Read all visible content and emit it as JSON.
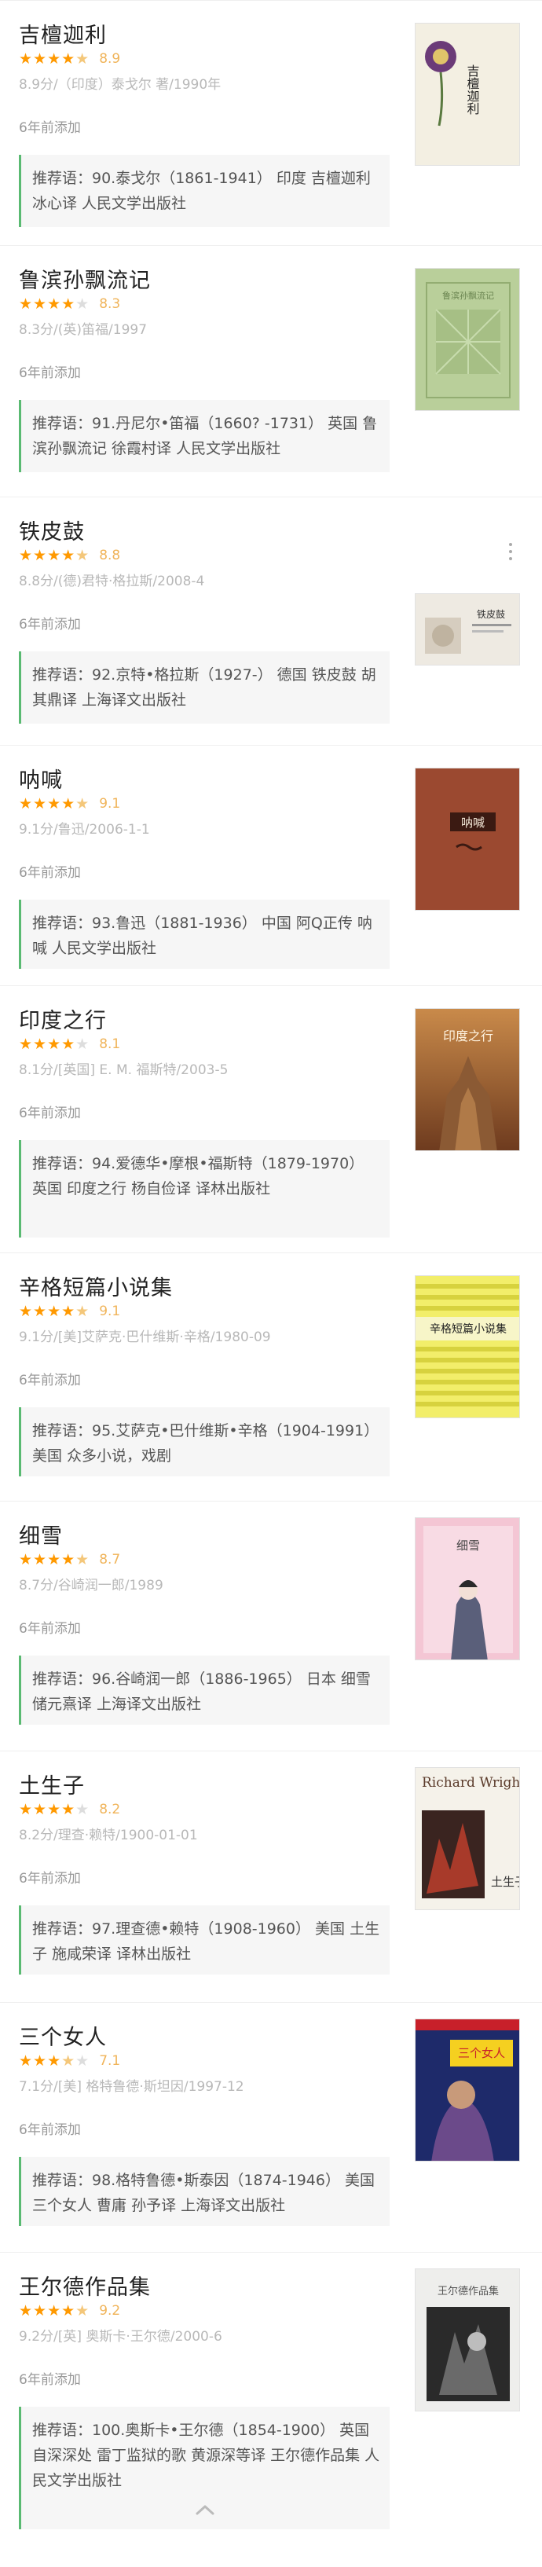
{
  "books": [
    {
      "title": "吉檀迦利",
      "stars": 4.5,
      "score": "8.9",
      "meta": "8.9分/（印度）泰戈尔 著/1990年",
      "added": "6年前添加",
      "recommendation": "推荐语：90.泰戈尔（1861-1941） 印度 吉檀迦利 冰心译 人民文学出版社",
      "cover_text": "吉檀迦利"
    },
    {
      "title": "鲁滨孙飘流记",
      "stars": 4,
      "score": "8.3",
      "meta": "8.3分/(英)笛福/1997",
      "added": "6年前添加",
      "recommendation": "推荐语：91.丹尼尔•笛福（1660? -1731） 英国 鲁滨孙飘流记 徐霞村译 人民文学出版社",
      "cover_text": "鲁滨孙飘流记"
    },
    {
      "title": "铁皮鼓",
      "stars": 4.5,
      "score": "8.8",
      "meta": "8.8分/(德)君特·格拉斯/2008-4",
      "added": "6年前添加",
      "recommendation": "推荐语：92.京特•格拉斯（1927-） 德国 铁皮鼓 胡其鼎译 上海译文出版社",
      "cover_text": "铁皮鼓"
    },
    {
      "title": "呐喊",
      "stars": 4.5,
      "score": "9.1",
      "meta": "9.1分/鲁迅/2006-1-1",
      "added": "6年前添加",
      "recommendation": "推荐语：93.鲁迅（1881-1936） 中国 阿Q正传 呐喊 人民文学出版社",
      "cover_text": "呐喊"
    },
    {
      "title": "印度之行",
      "stars": 4,
      "score": "8.1",
      "meta": "8.1分/[英国] E. M. 福斯特/2003-5",
      "added": "6年前添加",
      "recommendation": "推荐语：94.爱德华•摩根•福斯特（1879-1970） 英国 印度之行 杨自俭译 译林出版社",
      "cover_text": "印度之行"
    },
    {
      "title": "辛格短篇小说集",
      "stars": 4.5,
      "score": "9.1",
      "meta": "9.1分/[美]艾萨克·巴什维斯·辛格/1980-09",
      "added": "6年前添加",
      "recommendation": "推荐语：95.艾萨克•巴什维斯•辛格（1904-1991） 美国 众多小说，戏剧",
      "cover_text": "辛格短篇小说集"
    },
    {
      "title": "细雪",
      "stars": 4.5,
      "score": "8.7",
      "meta": "8.7分/谷崎润一郎/1989",
      "added": "6年前添加",
      "recommendation": "推荐语：96.谷崎润一郎（1886-1965） 日本 细雪 储元熹译 上海译文出版社",
      "cover_text": "细雪"
    },
    {
      "title": "土生子",
      "stars": 4,
      "score": "8.2",
      "meta": "8.2分/理查·赖特/1900-01-01",
      "added": "6年前添加",
      "recommendation": "推荐语：97.理查德•赖特（1908-1960） 美国 土生子 施咸荣译 译林出版社",
      "cover_text": "土生子",
      "cover_text_en": "Richard Wright"
    },
    {
      "title": "三个女人",
      "stars": 3.5,
      "score": "7.1",
      "meta": "7.1分/[美] 格特鲁德·斯坦因/1997-12",
      "added": "6年前添加",
      "recommendation": "推荐语：98.格特鲁德•斯泰因（1874-1946） 美国 三个女人 曹庸 孙予译 上海译文出版社",
      "cover_text": "三个女人"
    },
    {
      "title": "王尔德作品集",
      "stars": 4.5,
      "score": "9.2",
      "meta": "9.2分/[英] 奥斯卡·王尔德/2000-6",
      "added": "6年前添加",
      "recommendation": "推荐语：100.奥斯卡•王尔德（1854-1900） 英国 自深深处 雷丁监狱的歌 黄源深等译 王尔德作品集 人民文学出版社",
      "cover_text": "王尔德作品集"
    }
  ],
  "colors": {
    "star": "#ff9900",
    "accent_bar": "#5aba72",
    "rec_background": "#f6f6f6"
  },
  "icons": {
    "more": "more-vertical-icon",
    "collapse": "chevron-up-icon"
  }
}
